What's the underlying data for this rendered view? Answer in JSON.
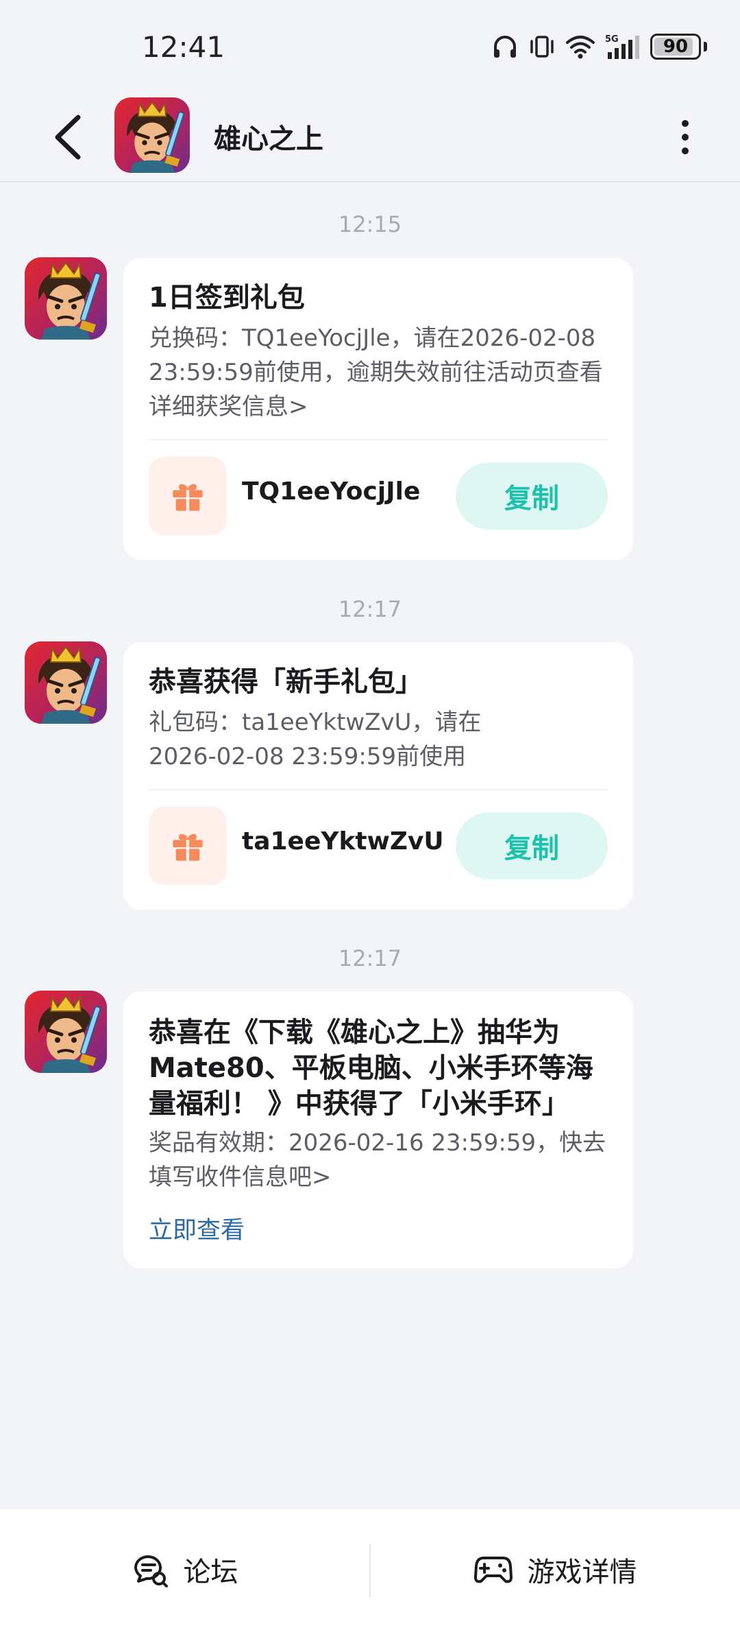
{
  "status_bar": {
    "time": "12:41",
    "network": "5G",
    "battery": "90",
    "battery_level": 0.9,
    "icons": [
      "headphones-icon",
      "vibrate-icon",
      "wifi-icon",
      "cellular-signal-icon",
      "battery-icon"
    ]
  },
  "header": {
    "title": "雄心之上",
    "back_icon": "chevron-left-icon",
    "more_icon": "more-vertical-icon"
  },
  "messages": [
    {
      "time": "12:15",
      "title": "1日签到礼包",
      "body": "兑换码：TQ1eeYocjJle，请在2026-02-08 23:59:59前使用，逾期失效前往活动页查看详细获奖信息>",
      "code": "TQ1eeYocjJle",
      "copy_label": "复制"
    },
    {
      "time": "12:17",
      "title": "恭喜获得「新手礼包」",
      "body": "礼包码：ta1eeYktwZvU，请在2026-02-08 23:59:59前使用",
      "code": "ta1eeYktwZvU",
      "copy_label": "复制"
    },
    {
      "time": "12:17",
      "title": "恭喜在《下载《雄心之上》抽华为Mate80、平板电脑、小米手环等海量福利！ 》中获得了「小米手环」",
      "body": "奖品有效期：2026-02-16 23:59:59，快去填写收件信息吧>",
      "link": "立即查看"
    }
  ],
  "bottom_bar": {
    "forum_label": "论坛",
    "forum_icon": "forum-chat-icon",
    "game_details_label": "游戏详情",
    "game_details_icon": "gamepad-icon"
  },
  "colors": {
    "accent_teal": "#1ec2ac",
    "copy_button_bg": "#dff7f3",
    "gift_orange": "#f58a5c",
    "link_blue": "#2b6aa6",
    "page_bg": "#f3f4f8"
  }
}
